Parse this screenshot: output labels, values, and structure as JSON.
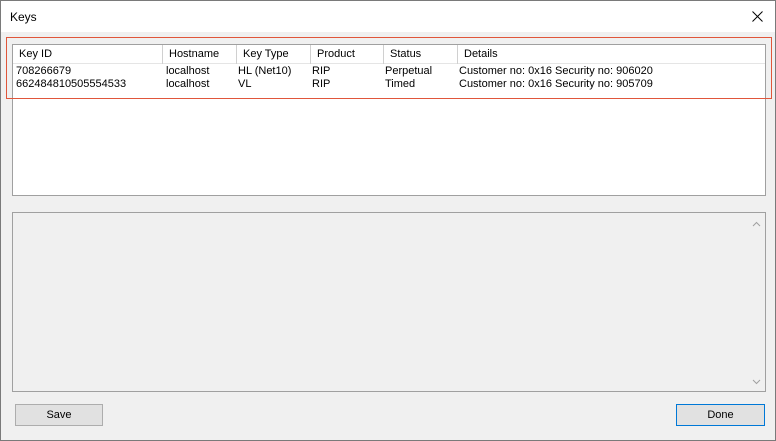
{
  "window": {
    "title": "Keys"
  },
  "keys_list": {
    "columns": [
      {
        "label": "Key ID"
      },
      {
        "label": "Hostname"
      },
      {
        "label": "Key Type"
      },
      {
        "label": "Product"
      },
      {
        "label": "Status"
      },
      {
        "label": "Details"
      }
    ],
    "rows": [
      {
        "key_id": "708266679",
        "hostname": "localhost",
        "key_type": "HL (Net10)",
        "product": "RIP",
        "status": "Perpetual",
        "details": "Customer no: 0x16  Security no: 906020"
      },
      {
        "key_id": "6624848105055545​33",
        "hostname": "localhost",
        "key_type": "VL",
        "product": "RIP",
        "status": "Timed",
        "details": "Customer no: 0x16  Security no: 905709"
      }
    ]
  },
  "buttons": {
    "save_label": "Save",
    "done_label": "Done"
  },
  "colors": {
    "highlight": "#e0563b",
    "focus_border": "#0078d7"
  },
  "icons": {
    "close": "close-icon",
    "scroll_up": "chevron-up-icon",
    "scroll_down": "chevron-down-icon"
  }
}
